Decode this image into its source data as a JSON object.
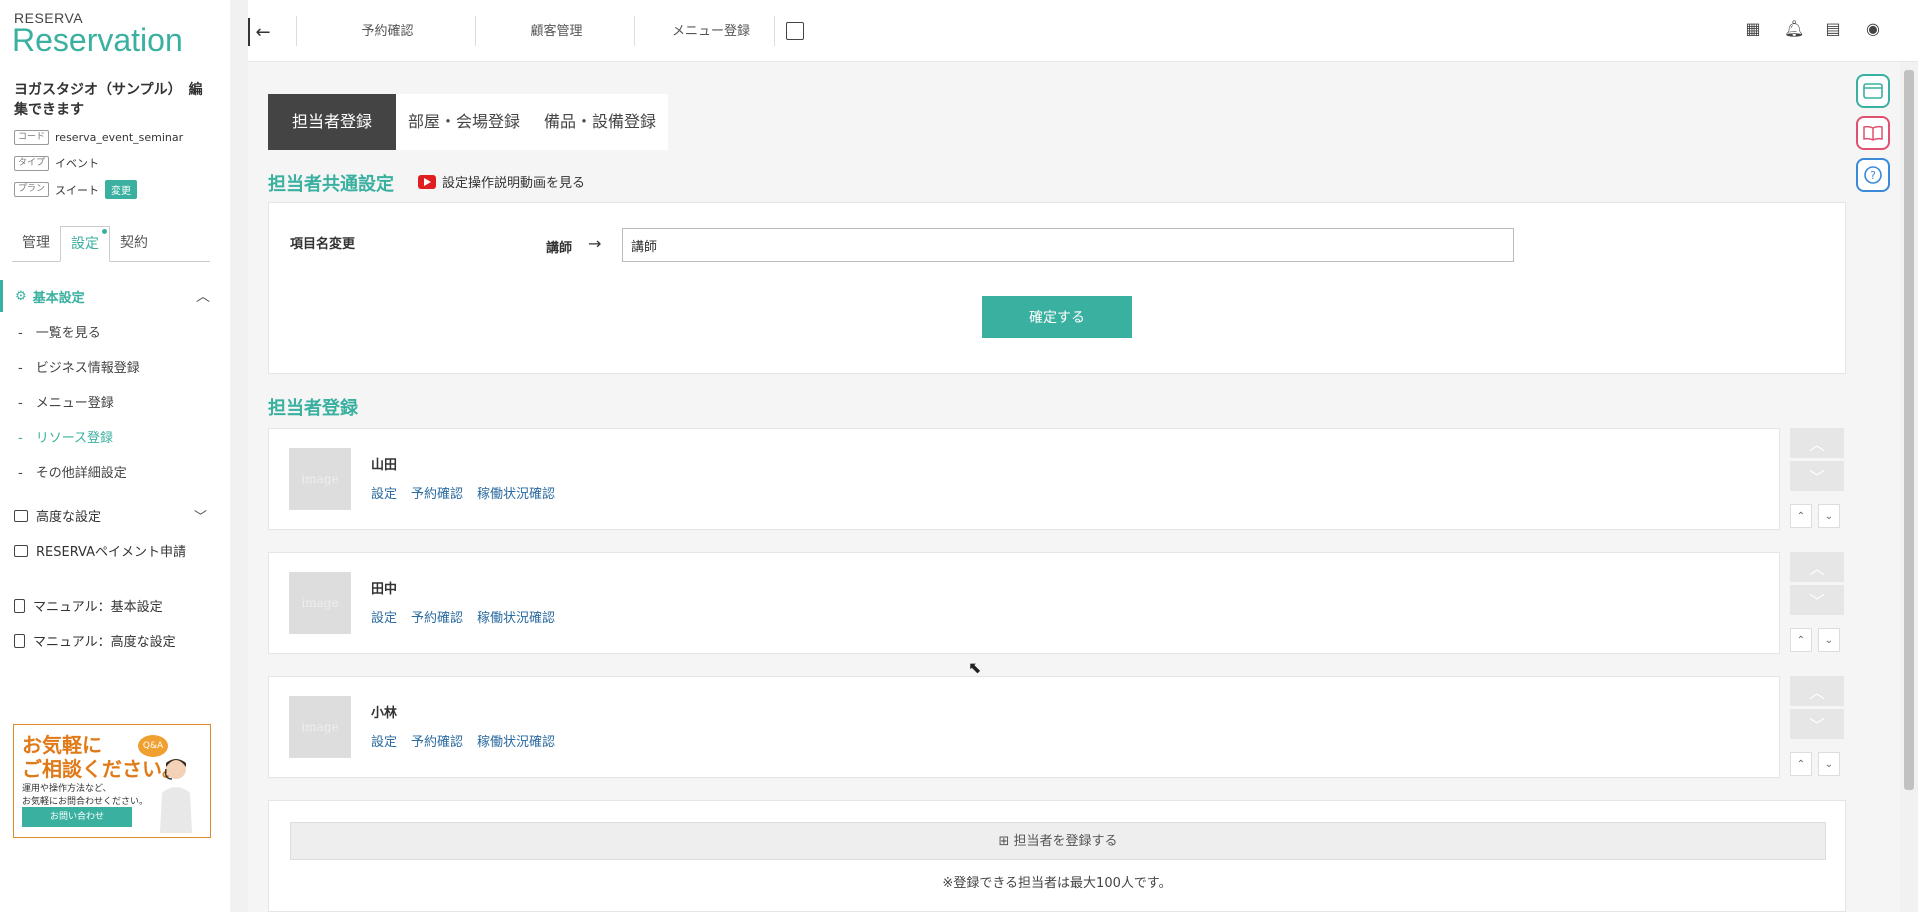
{
  "logo": {
    "top": "RESERVA",
    "main": "Reservation"
  },
  "store": {
    "name": "ヨガスタジオ（サンプル）　編集できます"
  },
  "meta": [
    {
      "tag": "コード",
      "value": "reserva_event_seminar"
    },
    {
      "tag": "タイプ",
      "value": "イベント"
    },
    {
      "tag": "プラン",
      "value": "スイート",
      "badge": "変更"
    }
  ],
  "sidebar_tabs": [
    "管理",
    "設定",
    "契約"
  ],
  "menu": {
    "head": "基本設定",
    "items": [
      "一覧を見る",
      "ビジネス情報登録",
      "メニュー登録",
      "リソース登録",
      "その他詳細設定"
    ],
    "advanced": "高度な設定",
    "payment": "RESERVAペイメント申請",
    "manual1": "マニュアル：基本設定",
    "manual2": "マニュアル：高度な設定"
  },
  "banner": {
    "title1": "お気軽に",
    "title2": "ご相談ください。",
    "body1": "運用や操作方法など、",
    "body2": "お気軽にお問合わせください。",
    "button": "お問い合わせ",
    "qa": "Q&A"
  },
  "topnav": [
    "予約確認",
    "顧客管理",
    "メニュー登録"
  ],
  "tabs": [
    "担当者登録",
    "部屋・会場登録",
    "備品・設備登録"
  ],
  "common": {
    "title": "担当者共通設定",
    "video_link": "設定操作説明動画を見る",
    "field_label": "項目名変更",
    "from": "講師",
    "arrow": "→",
    "input_value": "講師",
    "confirm": "確定する"
  },
  "staff": {
    "title": "担当者登録",
    "image_placeholder": "image",
    "links": [
      "設定",
      "予約確認",
      "稼働状況確認"
    ],
    "members": [
      "山田",
      "田中",
      "小林"
    ],
    "add_button": "担当者を登録する",
    "note": "※登録できる担当者は最大100人です。"
  }
}
